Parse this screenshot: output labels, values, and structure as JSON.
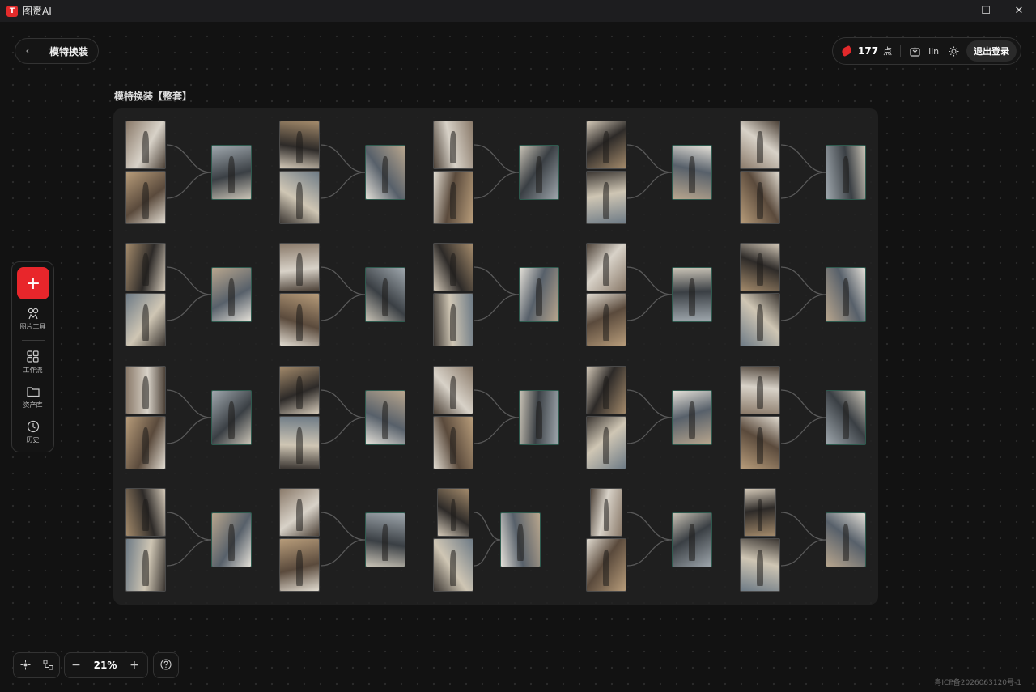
{
  "app": {
    "title": "图赉AI",
    "logo_text": "T"
  },
  "window": {
    "min": "—",
    "max": "☐",
    "close": "✕"
  },
  "header": {
    "back_icon": "chevron-left-icon",
    "page_title": "模特换装"
  },
  "account": {
    "points_value": "177",
    "points_unit": "点",
    "username": "lin",
    "logout_label": "退出登录"
  },
  "toolbar": {
    "add_label": "+",
    "items": [
      {
        "label": "图片工具",
        "icon": "image-tool-icon"
      },
      {
        "label": "工作流",
        "icon": "workflow-icon"
      },
      {
        "label": "资产库",
        "icon": "folder-icon"
      },
      {
        "label": "历史",
        "icon": "clock-icon"
      }
    ]
  },
  "group": {
    "title": "模特换装【整套】"
  },
  "zoom": {
    "value": "21%",
    "minus": "−",
    "plus": "+"
  },
  "help_icon": "help-circle-icon",
  "footer": {
    "icp": "粤ICP备2026063120号-1"
  },
  "colors": {
    "accent": "#e8262b",
    "background": "#121212",
    "output_border": "#2e5a4e"
  }
}
